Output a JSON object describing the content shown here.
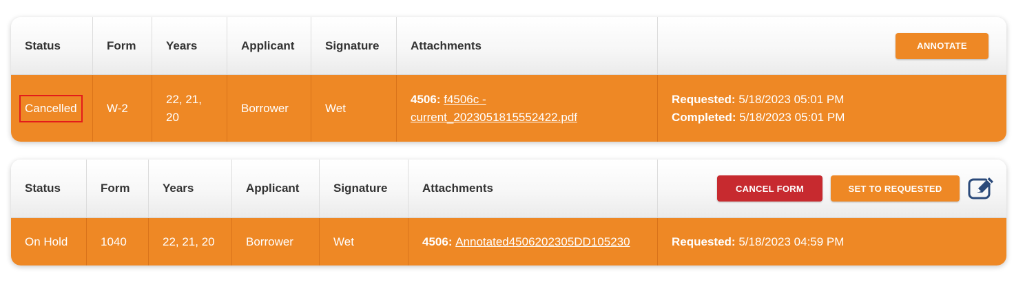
{
  "colors": {
    "row_orange": "#ee8825",
    "cancel_red": "#c72a2f",
    "highlight_red": "#e31b1b",
    "icon_blue": "#2b4a7a"
  },
  "headers": {
    "status": "Status",
    "form": "Form",
    "years": "Years",
    "applicant": "Applicant",
    "signature": "Signature",
    "attachments": "Attachments"
  },
  "card1": {
    "annotate_label": "ANNOTATE",
    "row": {
      "status": "Cancelled",
      "form": "W-2",
      "years_line1": "22, 21,",
      "years_line2": "20",
      "applicant": "Borrower",
      "signature": "Wet",
      "attachment_label": "4506:",
      "attachment_link_line1": "f4506c -",
      "attachment_link_line2": "current_2023051815552422.pdf",
      "requested_label": "Requested:",
      "requested_value": "5/18/2023 05:01 PM",
      "completed_label": "Completed:",
      "completed_value": "5/18/2023 05:01 PM"
    }
  },
  "card2": {
    "cancel_form_label": "CANCEL FORM",
    "set_requested_label": "SET TO REQUESTED",
    "edit_icon": "edit-icon",
    "row": {
      "status": "On Hold",
      "form": "1040",
      "years": "22, 21, 20",
      "applicant": "Borrower",
      "signature": "Wet",
      "attachment_label": "4506:",
      "attachment_link": "Annotated4506202305DD105230",
      "requested_label": "Requested:",
      "requested_value": "5/18/2023 04:59 PM"
    }
  }
}
